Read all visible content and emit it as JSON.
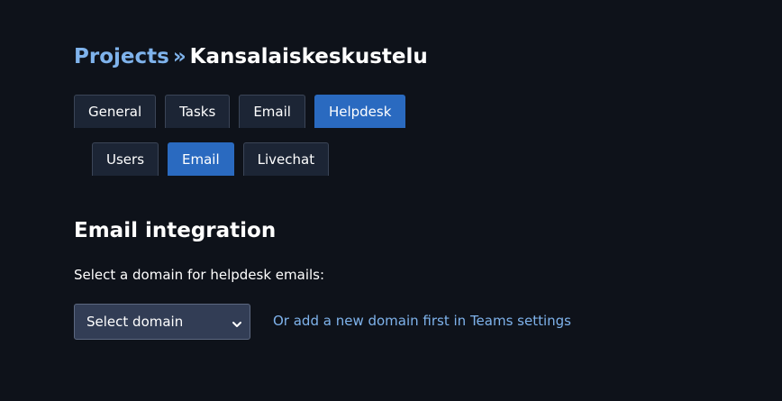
{
  "breadcrumb": {
    "root_label": "Projects",
    "separator": "»",
    "current_label": "Kansalaiskeskustelu"
  },
  "main_tabs": [
    {
      "label": "General",
      "active": false
    },
    {
      "label": "Tasks",
      "active": false
    },
    {
      "label": "Email",
      "active": false
    },
    {
      "label": "Helpdesk",
      "active": true
    }
  ],
  "sub_tabs": [
    {
      "label": "Users",
      "active": false
    },
    {
      "label": "Email",
      "active": true
    },
    {
      "label": "Livechat",
      "active": false
    }
  ],
  "section": {
    "title": "Email integration",
    "select_label": "Select a domain for helpdesk emails:",
    "select_value": "Select domain",
    "select_icon": "chevron-down-icon",
    "teams_link": "Or add a new domain first in Teams settings"
  },
  "colors": {
    "background": "#0e121a",
    "accent_link": "#7fb3ec",
    "active_tab": "#2a6ac0",
    "tab": "#1c2535",
    "select_bg": "#323d55"
  }
}
